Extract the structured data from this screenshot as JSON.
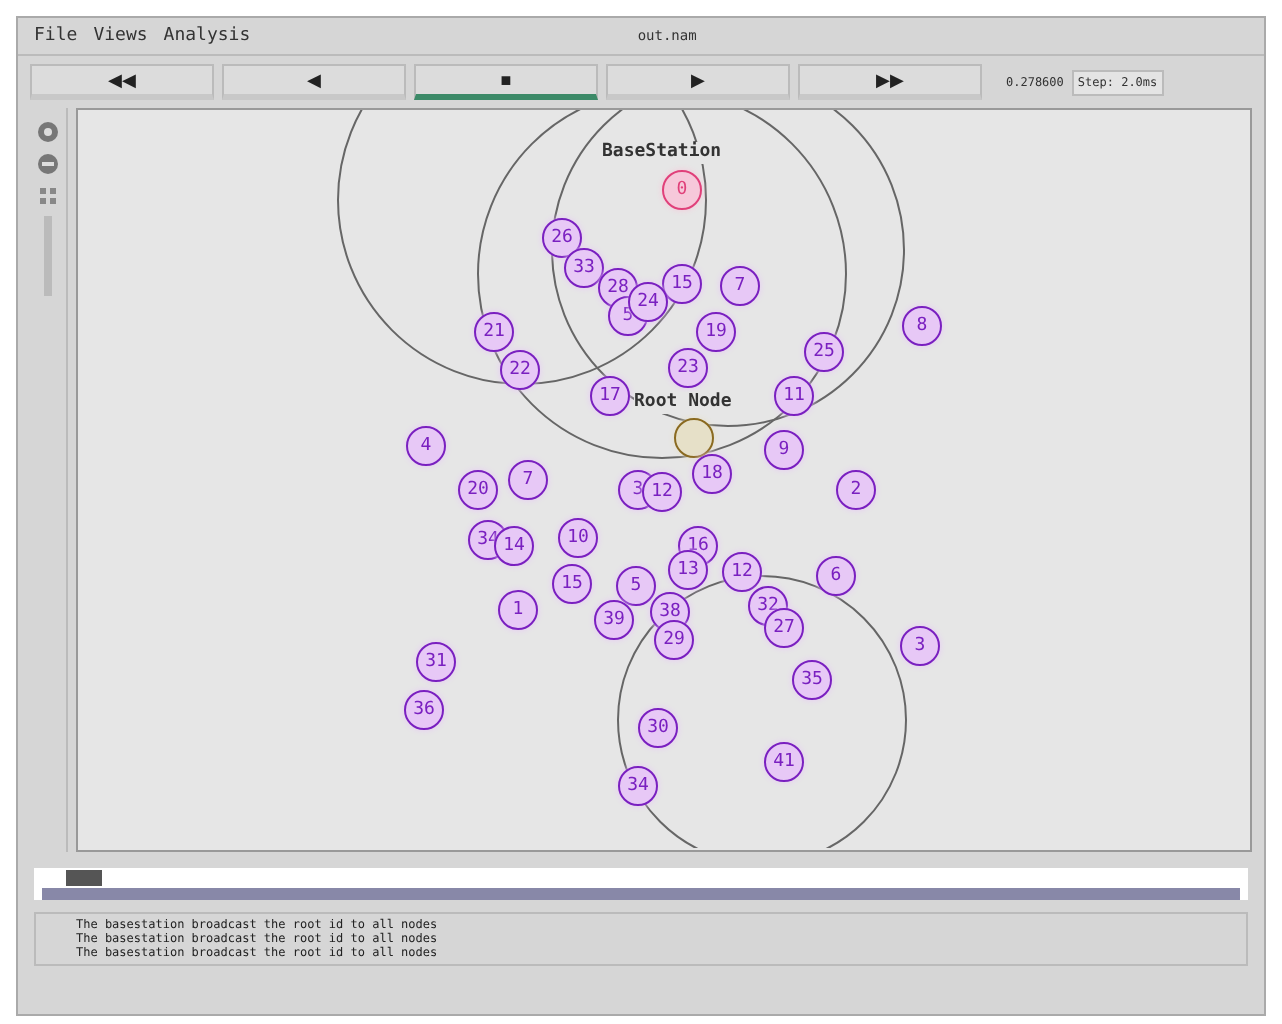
{
  "window": {
    "title": "out.nam"
  },
  "menu": [
    "File",
    "Views",
    "Analysis"
  ],
  "controls": [
    {
      "symbol": "◀◀",
      "selected": false
    },
    {
      "symbol": "◀",
      "selected": false
    },
    {
      "symbol": "■",
      "selected": true
    },
    {
      "symbol": "▶",
      "selected": false
    },
    {
      "symbol": "▶▶",
      "selected": false
    }
  ],
  "time": "0.278600",
  "step": "Step: 2.0ms",
  "nodes": [
    {
      "label": "0",
      "kind": "base",
      "caption": "BaseStation"
    },
    {
      "label": "26",
      "kind": "node"
    },
    {
      "label": "33",
      "kind": "node"
    },
    {
      "label": "28",
      "kind": "node"
    },
    {
      "label": "15",
      "kind": "node"
    },
    {
      "label": "7",
      "kind": "node"
    },
    {
      "label": "5",
      "kind": "node"
    },
    {
      "label": "24",
      "kind": "node"
    },
    {
      "label": "21",
      "kind": "node"
    },
    {
      "label": "19",
      "kind": "node"
    },
    {
      "label": "8",
      "kind": "node"
    },
    {
      "label": "25",
      "kind": "node"
    },
    {
      "label": "22",
      "kind": "node"
    },
    {
      "label": "23",
      "kind": "node"
    },
    {
      "label": "17",
      "kind": "node"
    },
    {
      "label": "11",
      "kind": "node"
    },
    {
      "label": "4",
      "kind": "node"
    },
    {
      "kind": "root",
      "caption": "Root Node"
    },
    {
      "label": "9",
      "kind": "node"
    },
    {
      "label": "20",
      "kind": "node"
    },
    {
      "label": "7",
      "kind": "node"
    },
    {
      "label": "3",
      "kind": "node"
    },
    {
      "label": "12",
      "kind": "node"
    },
    {
      "label": "18",
      "kind": "node"
    },
    {
      "label": "2",
      "kind": "node"
    },
    {
      "label": "34",
      "kind": "node"
    },
    {
      "label": "14",
      "kind": "node"
    },
    {
      "label": "10",
      "kind": "node"
    },
    {
      "label": "16",
      "kind": "node"
    },
    {
      "label": "15",
      "kind": "node"
    },
    {
      "label": "5",
      "kind": "node"
    },
    {
      "label": "13",
      "kind": "node"
    },
    {
      "label": "12",
      "kind": "node"
    },
    {
      "label": "6",
      "kind": "node"
    },
    {
      "label": "1",
      "kind": "node"
    },
    {
      "label": "39",
      "kind": "node"
    },
    {
      "label": "38",
      "kind": "node"
    },
    {
      "label": "32",
      "kind": "node"
    },
    {
      "label": "27",
      "kind": "node"
    },
    {
      "label": "29",
      "kind": "node"
    },
    {
      "label": "3",
      "kind": "node"
    },
    {
      "label": "31",
      "kind": "node"
    },
    {
      "label": "35",
      "kind": "node"
    },
    {
      "label": "36",
      "kind": "node"
    },
    {
      "label": "30",
      "kind": "node"
    },
    {
      "label": "41",
      "kind": "node"
    },
    {
      "label": "34",
      "kind": "node"
    }
  ],
  "timeline": {
    "level": 0.02
  },
  "log": [
    "The basestation broadcast the root id to all nodes",
    "The basestation broadcast the root id to all nodes",
    "The basestation broadcast the root id to all nodes"
  ]
}
